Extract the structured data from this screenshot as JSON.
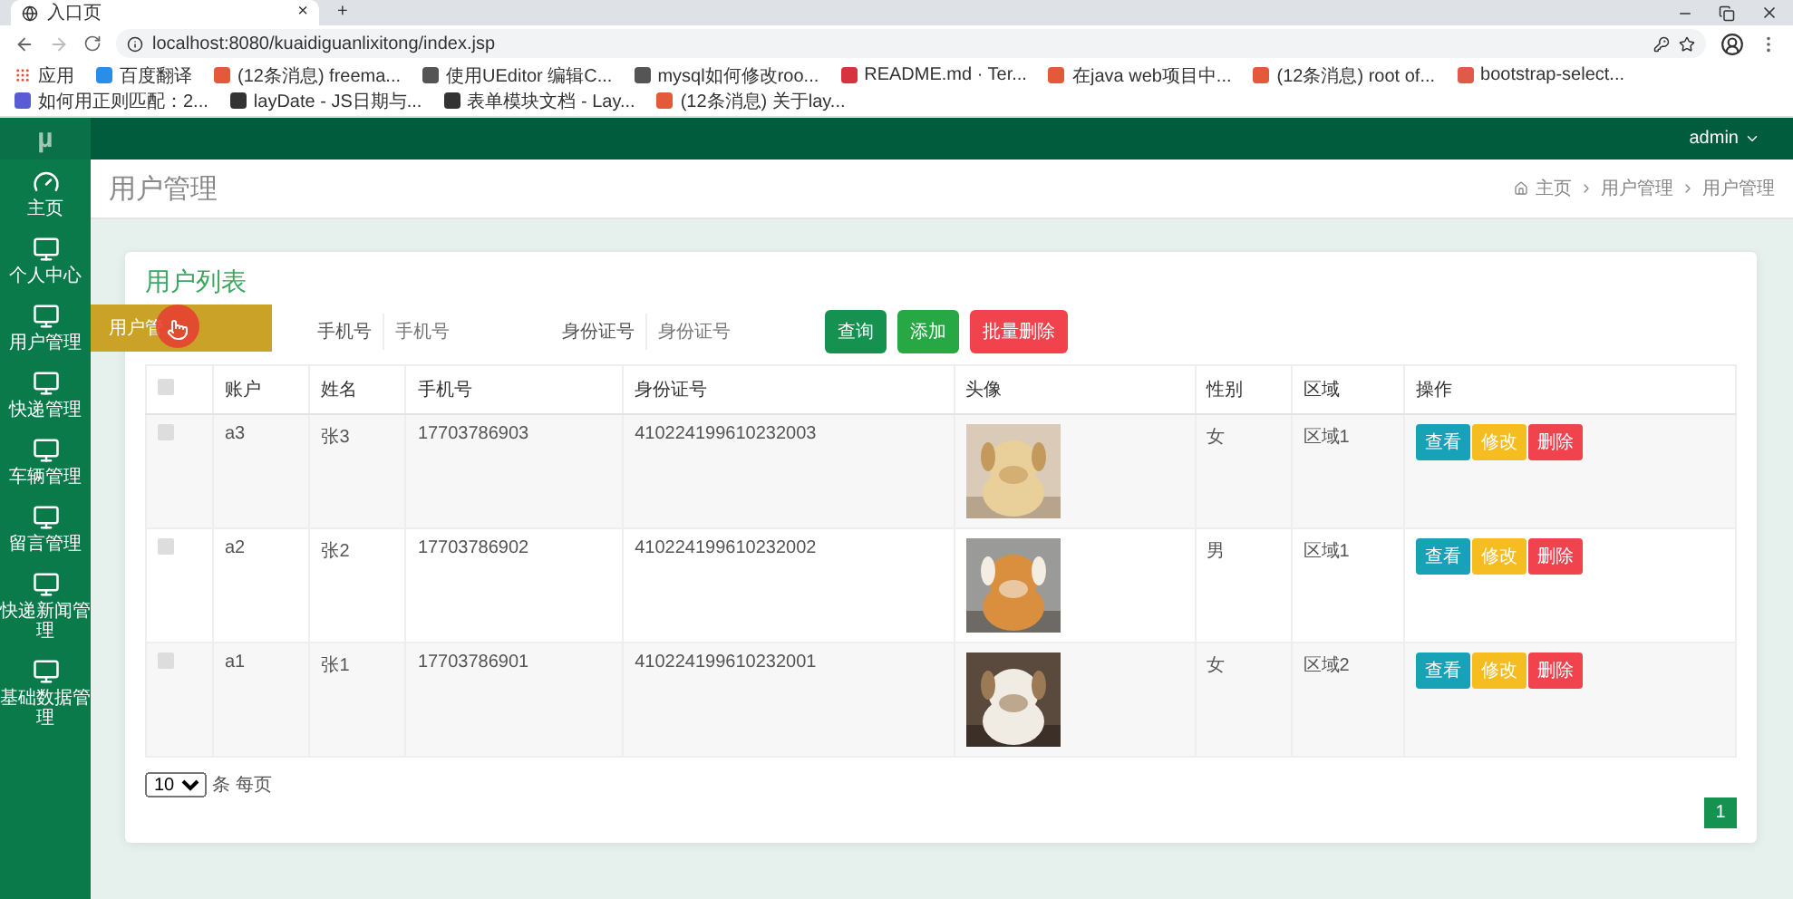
{
  "browser": {
    "tab": {
      "title": "入口页",
      "close": "×"
    },
    "new_tab": "+",
    "url": "localhost:8080/kuaidiguanlixitong/index.jsp",
    "bookmarks": [
      {
        "label": "应用",
        "color": "#e0533a"
      },
      {
        "label": "百度翻译",
        "color": "#2a8ee8"
      },
      {
        "label": "(12条消息) freema...",
        "color": "#e4593a"
      },
      {
        "label": "使用UEditor 编辑C...",
        "color": "#555555"
      },
      {
        "label": "mysql如何修改roo...",
        "color": "#555555"
      },
      {
        "label": "README.md · Ter...",
        "color": "#d6333f"
      },
      {
        "label": "在java web项目中...",
        "color": "#e4593a"
      },
      {
        "label": "(12条消息) root of...",
        "color": "#e4593a"
      },
      {
        "label": "bootstrap-select...",
        "color": "#e05a4a"
      },
      {
        "label": "如何用正则匹配：2...",
        "color": "#5b5bd6"
      },
      {
        "label": "layDate - JS日期与...",
        "color": "#333333"
      },
      {
        "label": "表单模块文档 - Lay...",
        "color": "#333333"
      },
      {
        "label": "(12条消息) 关于lay...",
        "color": "#e4593a"
      }
    ]
  },
  "app": {
    "logo": "µ",
    "user": "admin"
  },
  "sidebar": {
    "items": [
      {
        "label": "主页",
        "kind": "home"
      },
      {
        "label": "个人中心",
        "kind": "page"
      },
      {
        "label": "用户管理",
        "kind": "page",
        "flyout": "用户管"
      },
      {
        "label": "快递管理",
        "kind": "page"
      },
      {
        "label": "车辆管理",
        "kind": "page"
      },
      {
        "label": "留言管理",
        "kind": "page"
      },
      {
        "label": "快递新闻管理",
        "kind": "page"
      },
      {
        "label": "基础数据管理",
        "kind": "page"
      }
    ]
  },
  "page": {
    "title": "用户管理",
    "breadcrumb": [
      "主页",
      "用户管理",
      "用户管理"
    ]
  },
  "card": {
    "title": "用户列表",
    "filters": [
      {
        "label": "手机号",
        "placeholder": "手机号"
      },
      {
        "label": "身份证号",
        "placeholder": "身份证号"
      }
    ],
    "buttons": [
      {
        "label": "查询",
        "kind": "search"
      },
      {
        "label": "添加",
        "kind": "add"
      },
      {
        "label": "批量删除",
        "kind": "delete"
      }
    ],
    "table": {
      "header_checked": false,
      "columns": [
        "账户",
        "姓名",
        "手机号",
        "身份证号",
        "头像",
        "性别",
        "区域",
        "操作"
      ],
      "rows": [
        {
          "checked": false,
          "cells": [
            "a3",
            "张3",
            "17703786903",
            "410224199610232003"
          ],
          "avatar": {
            "kind": "picture"
          },
          "gender": "女",
          "region": "区域1",
          "actions": [
            {
              "label": "查看",
              "kind": "view"
            },
            {
              "label": "修改",
              "kind": "edit"
            },
            {
              "label": "删除",
              "kind": "delete"
            }
          ]
        },
        {
          "checked": false,
          "cells": [
            "a2",
            "张2",
            "17703786902",
            "410224199610232002"
          ],
          "avatar": {
            "kind": "picture"
          },
          "gender": "男",
          "region": "区域1",
          "actions": [
            {
              "label": "查看",
              "kind": "view"
            },
            {
              "label": "修改",
              "kind": "edit"
            },
            {
              "label": "删除",
              "kind": "delete"
            }
          ]
        },
        {
          "checked": false,
          "cells": [
            "a1",
            "张1",
            "17703786901",
            "410224199610232001"
          ],
          "avatar": {
            "kind": "picture"
          },
          "gender": "女",
          "region": "区域2",
          "actions": [
            {
              "label": "查看",
              "kind": "view"
            },
            {
              "label": "修改",
              "kind": "edit"
            },
            {
              "label": "删除",
              "kind": "delete"
            }
          ]
        }
      ]
    },
    "page_size": "10",
    "page_size_suffix": "条 每页",
    "pages": [
      {
        "label": "1",
        "selected": true
      }
    ]
  }
}
